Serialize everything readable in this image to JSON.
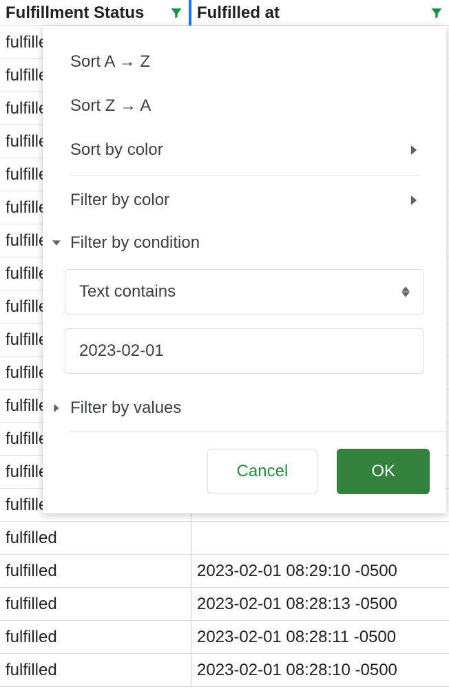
{
  "columns": {
    "col1_label": "Fulfillment Status",
    "col2_label": "Fulfilled at"
  },
  "rows": [
    {
      "status": "fulfilled",
      "at": ""
    },
    {
      "status": "fulfilled",
      "at": ""
    },
    {
      "status": "fulfilled",
      "at": ""
    },
    {
      "status": "fulfilled",
      "at": ""
    },
    {
      "status": "fulfilled",
      "at": ""
    },
    {
      "status": "fulfilled",
      "at": ""
    },
    {
      "status": "fulfilled",
      "at": ""
    },
    {
      "status": "fulfilled",
      "at": ""
    },
    {
      "status": "fulfilled",
      "at": ""
    },
    {
      "status": "fulfilled",
      "at": ""
    },
    {
      "status": "fulfilled",
      "at": ""
    },
    {
      "status": "fulfilled",
      "at": ""
    },
    {
      "status": "fulfilled",
      "at": ""
    },
    {
      "status": "fulfilled",
      "at": ""
    },
    {
      "status": "fulfilled",
      "at": ""
    },
    {
      "status": "fulfilled",
      "at": ""
    },
    {
      "status": "fulfilled",
      "at": "2023-02-01 08:29:10 -0500"
    },
    {
      "status": "fulfilled",
      "at": "2023-02-01 08:28:13 -0500"
    },
    {
      "status": "fulfilled",
      "at": "2023-02-01 08:28:11 -0500"
    },
    {
      "status": "fulfilled",
      "at": "2023-02-01 08:28:10 -0500"
    }
  ],
  "dropdown": {
    "sort_az": "Sort A → Z",
    "sort_za": "Sort Z → A",
    "sort_color": "Sort by color",
    "filter_color": "Filter by color",
    "filter_condition": "Filter by condition",
    "condition_type": "Text contains",
    "condition_value": "2023-02-01",
    "filter_values": "Filter by values",
    "cancel": "Cancel",
    "ok": "OK"
  }
}
